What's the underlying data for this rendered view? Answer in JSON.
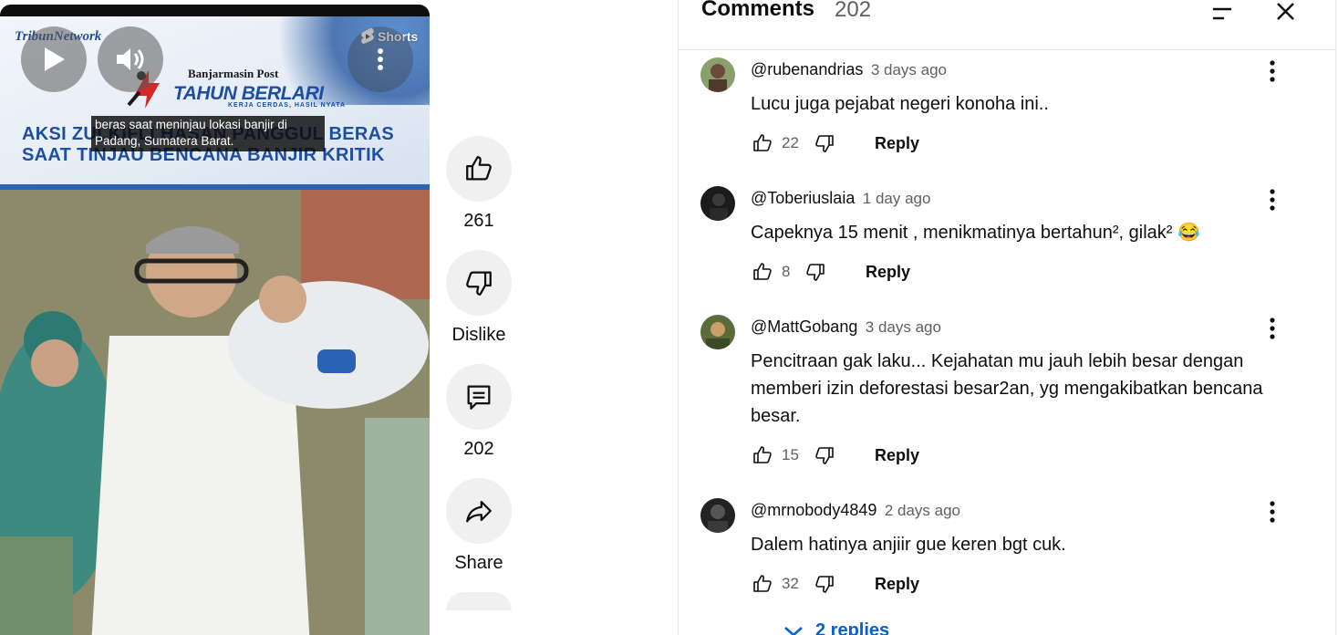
{
  "video": {
    "brand": "TribunNetwork",
    "paper_name": "Banjarmasin Post",
    "tagline": "TAHUN BERLARI",
    "subtag": "KERJA CERDAS, HASIL NYATA",
    "headline": "AKSI ZULKIFLI HASAN PANGGUL BERAS SAAT TINJAU BENCANA BANJIR KRITIK",
    "caption": "beras saat meninjau lokasi banjir di Padang, Sumatera Barat.",
    "shorts_label": "Shorts",
    "icons": {
      "play": "play-icon",
      "volume": "volume-icon",
      "more": "more-vertical-icon"
    }
  },
  "actions": {
    "like": {
      "icon": "thumb-up-icon",
      "label": "261"
    },
    "dislike": {
      "icon": "thumb-down-icon",
      "label": "Dislike"
    },
    "comments": {
      "icon": "comment-icon",
      "label": "202"
    },
    "share": {
      "icon": "share-icon",
      "label": "Share"
    }
  },
  "panel": {
    "title": "Comments",
    "count": "202",
    "sort_icon": "sort-icon",
    "close_icon": "close-icon"
  },
  "comments": [
    {
      "user": "@rubenandrias",
      "time": "3 days ago",
      "text": "Lucu juga pejabat negeri konoha ini..",
      "likes": "22",
      "reply": "Reply"
    },
    {
      "user": "@Toberiuslaia",
      "time": "1 day ago",
      "text": "Capeknya 15 menit , menikmatinya bertahun², gilak² 😂",
      "likes": "8",
      "reply": "Reply"
    },
    {
      "user": "@MattGobang",
      "time": "3 days ago",
      "text": "Pencitraan gak laku... Kejahatan mu jauh lebih besar dengan memberi izin deforestasi besar2an, yg mengakibatkan bencana besar.",
      "likes": "15",
      "reply": "Reply"
    },
    {
      "user": "@mrnobody4849",
      "time": "2 days ago",
      "text": "Dalem hatinya anjiir gue keren bgt cuk.",
      "likes": "32",
      "reply": "Reply"
    }
  ],
  "replies_toggle": "2 replies",
  "colors": {
    "accent": "#065fd4",
    "secondary_text": "#606060",
    "brand_blue": "#1e4ea0"
  }
}
